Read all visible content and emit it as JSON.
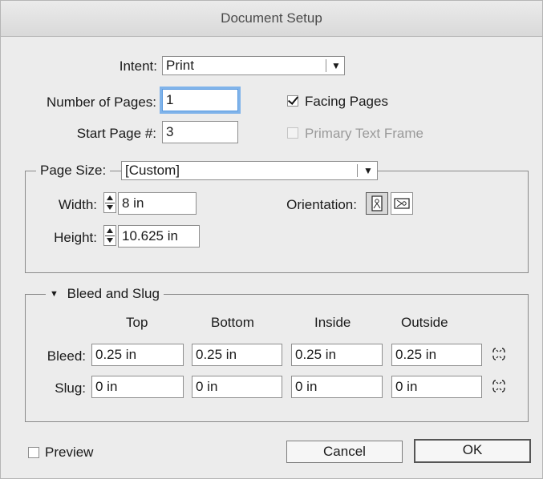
{
  "window": {
    "title": "Document Setup"
  },
  "intent": {
    "label": "Intent:",
    "value": "Print"
  },
  "pages": {
    "label": "Number of Pages:",
    "value": "1"
  },
  "facing": {
    "label": "Facing Pages",
    "checked": true
  },
  "start": {
    "label": "Start Page #:",
    "value": "3"
  },
  "primary": {
    "label": "Primary Text Frame",
    "checked": false,
    "disabled": true
  },
  "page_size": {
    "label": "Page Size:",
    "value": "[Custom]",
    "width_label": "Width:",
    "width_value": "8 in",
    "height_label": "Height:",
    "height_value": "10.625 in",
    "orientation_label": "Orientation:"
  },
  "bleed_slug": {
    "label": "Bleed and Slug",
    "columns": [
      "Top",
      "Bottom",
      "Inside",
      "Outside"
    ],
    "bleed_label": "Bleed:",
    "bleed_values": [
      "0.25 in",
      "0.25 in",
      "0.25 in",
      "0.25 in"
    ],
    "slug_label": "Slug:",
    "slug_values": [
      "0 in",
      "0 in",
      "0 in",
      "0 in"
    ]
  },
  "preview": {
    "label": "Preview",
    "checked": false
  },
  "buttons": {
    "cancel": "Cancel",
    "ok": "OK"
  }
}
